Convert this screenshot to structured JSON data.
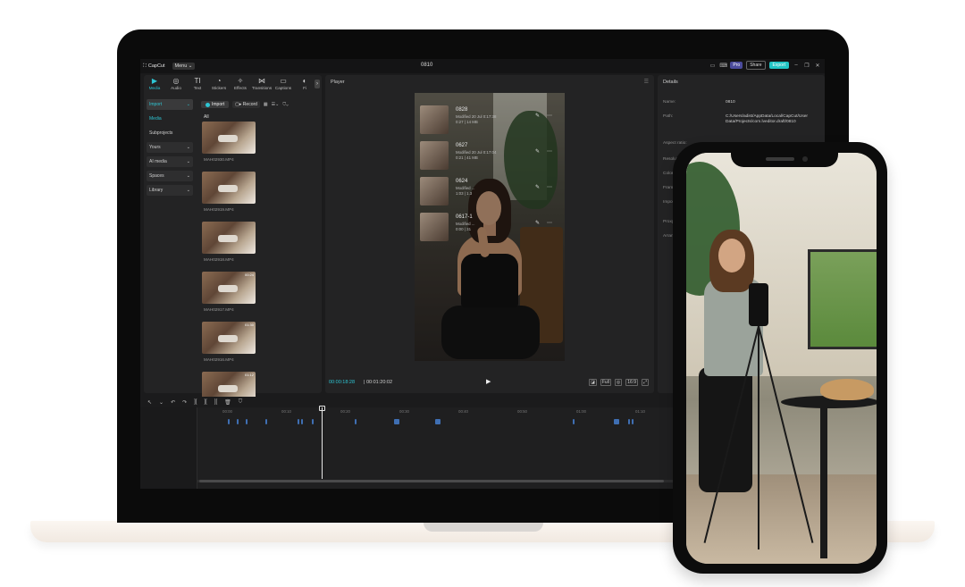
{
  "app": {
    "logo_text": "CapCut",
    "menu_label": "Menu ⌄",
    "project_title": "0810",
    "pro_label": "Pro",
    "share_label": "Share",
    "export_label": "Export",
    "accent_color": "#2ec5d3"
  },
  "toolbar": {
    "tabs": [
      {
        "label": "Media",
        "icon": "media-icon",
        "glyph": "▶"
      },
      {
        "label": "Audio",
        "icon": "audio-icon",
        "glyph": "◎"
      },
      {
        "label": "Text",
        "icon": "text-icon",
        "glyph": "TI"
      },
      {
        "label": "Stickers",
        "icon": "stickers-icon",
        "glyph": "◔"
      },
      {
        "label": "Effects",
        "icon": "effects-icon",
        "glyph": "✧"
      },
      {
        "label": "Transitions",
        "icon": "transitions-icon",
        "glyph": "⋈"
      },
      {
        "label": "Captions",
        "icon": "captions-icon",
        "glyph": "▭"
      },
      {
        "label": "Fi",
        "icon": "filters-icon",
        "glyph": "◐"
      }
    ]
  },
  "sidenav": {
    "items": [
      {
        "label": "Import",
        "state": "selected",
        "chevron": "⌄"
      },
      {
        "label": "Media",
        "state": "cyan",
        "chevron": ""
      },
      {
        "label": "Subprojects",
        "state": "plain",
        "chevron": ""
      },
      {
        "label": "Yours",
        "state": "boxed",
        "chevron": "⌄"
      },
      {
        "label": "AI media",
        "state": "boxed",
        "chevron": "⌄"
      },
      {
        "label": "Spaces",
        "state": "boxed",
        "chevron": "⌄"
      },
      {
        "label": "Library",
        "state": "boxed",
        "chevron": "⌄"
      }
    ]
  },
  "media": {
    "import_label": "Import",
    "record_label": "Record",
    "all_label": "All",
    "items": [
      {
        "name": "MAH02930.MP4",
        "duration": ""
      },
      {
        "name": "MAH02919.MP4",
        "duration": ""
      },
      {
        "name": "MAH02918.MP4",
        "duration": ""
      },
      {
        "name": "MAH02917.MP4",
        "duration": "00:24"
      },
      {
        "name": "MAH02916.MP4",
        "duration": "01:30"
      },
      {
        "name": "",
        "duration": "01:12"
      }
    ]
  },
  "player": {
    "header": "Player",
    "current_time": "00:00:18:28",
    "total_time": "00:01:20:02",
    "clips": [
      {
        "title": "0828",
        "meta1": "Modified 20 Jul 0:17:38",
        "meta2": "0:27 | 14 MB"
      },
      {
        "title": "0627",
        "meta1": "Modified 20 Jul 0:17:04",
        "meta2": "0:21 | 41 MB"
      },
      {
        "title": "0624",
        "meta1": "Modified ...",
        "meta2": "1:03 | 1.3"
      },
      {
        "title": "0617-1",
        "meta1": "Modified ...",
        "meta2": "0:00 | 31"
      }
    ],
    "tools": [
      "◪",
      "Full",
      "◎",
      "16:9",
      "⤢"
    ]
  },
  "details": {
    "header": "Details",
    "rows": [
      {
        "label": "Name:",
        "value": "0810"
      },
      {
        "label": "Path:",
        "value": "C:/Users/adist/AppData/Local/CapCut/User Data/Projects/com.lveditor.draft/0810"
      },
      {
        "label": "Aspect ratio:",
        "value": ""
      },
      {
        "label": "Resolution:",
        "value": ""
      },
      {
        "label": "Color space:",
        "value": ""
      },
      {
        "label": "Frame rate:",
        "value": ""
      },
      {
        "label": "Import:",
        "value": ""
      },
      {
        "label": "Proxy:",
        "value": ""
      },
      {
        "label": "Arrange:",
        "value": ""
      }
    ]
  },
  "timeline": {
    "ruler": [
      "00:00",
      "00:10",
      "00:20",
      "00:30",
      "00:40",
      "00:50",
      "01:00",
      "01:10"
    ],
    "tools": [
      "↖",
      "⌄",
      "↶",
      "↷",
      "][",
      "][",
      "][",
      "🗑",
      "⛉"
    ]
  }
}
